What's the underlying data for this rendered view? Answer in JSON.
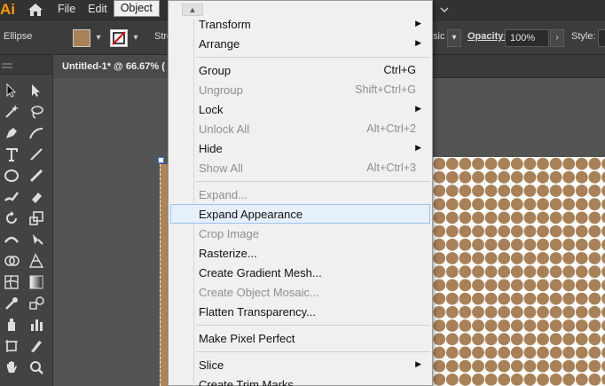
{
  "app": {
    "logo": "Ai"
  },
  "menubar": {
    "items": [
      {
        "label": "File"
      },
      {
        "label": "Edit"
      },
      {
        "label": "Object"
      }
    ]
  },
  "controlbar": {
    "selection_label": "Ellipse",
    "fill_color": "#a88158",
    "stroke_label": "Stro",
    "blend_label": "sic",
    "opacity_label": "Opacity:",
    "opacity_value": "100%",
    "style_label": "Style:"
  },
  "document": {
    "tab_title": "Untitled-1* @ 66.67% ("
  },
  "object_menu": {
    "items": [
      {
        "label": "Transform",
        "shortcut": "",
        "submenu": true,
        "disabled": false
      },
      {
        "label": "Arrange",
        "shortcut": "",
        "submenu": true,
        "disabled": false
      },
      {
        "label": "Group",
        "shortcut": "Ctrl+G",
        "submenu": false,
        "disabled": false
      },
      {
        "label": "Ungroup",
        "shortcut": "Shift+Ctrl+G",
        "submenu": false,
        "disabled": true
      },
      {
        "label": "Lock",
        "shortcut": "",
        "submenu": true,
        "disabled": false
      },
      {
        "label": "Unlock All",
        "shortcut": "Alt+Ctrl+2",
        "submenu": false,
        "disabled": true
      },
      {
        "label": "Hide",
        "shortcut": "",
        "submenu": true,
        "disabled": false
      },
      {
        "label": "Show All",
        "shortcut": "Alt+Ctrl+3",
        "submenu": false,
        "disabled": true
      },
      {
        "label": "Expand...",
        "shortcut": "",
        "submenu": false,
        "disabled": true
      },
      {
        "label": "Expand Appearance",
        "shortcut": "",
        "submenu": false,
        "disabled": false,
        "highlighted": true
      },
      {
        "label": "Crop Image",
        "shortcut": "",
        "submenu": false,
        "disabled": true
      },
      {
        "label": "Rasterize...",
        "shortcut": "",
        "submenu": false,
        "disabled": false
      },
      {
        "label": "Create Gradient Mesh...",
        "shortcut": "",
        "submenu": false,
        "disabled": false
      },
      {
        "label": "Create Object Mosaic...",
        "shortcut": "",
        "submenu": false,
        "disabled": true
      },
      {
        "label": "Flatten Transparency...",
        "shortcut": "",
        "submenu": false,
        "disabled": false
      },
      {
        "label": "Make Pixel Perfect",
        "shortcut": "",
        "submenu": false,
        "disabled": false
      },
      {
        "label": "Slice",
        "shortcut": "",
        "submenu": true,
        "disabled": false
      },
      {
        "label": "Create Trim Marks",
        "shortcut": "",
        "submenu": false,
        "disabled": false
      }
    ]
  },
  "colors": {
    "dot_fill": "#a88158",
    "artboard_fill": "#ae8557",
    "menu_highlight": "#e5f0fb",
    "accent": "#ff9a00"
  },
  "icons": [
    "selection-tool-icon",
    "direct-selection-tool-icon",
    "magic-wand-icon",
    "lasso-icon",
    "pen-tool-icon",
    "curvature-tool-icon",
    "type-tool-icon",
    "line-tool-icon",
    "ellipse-tool-icon",
    "pencil-tool-icon",
    "paintbrush-icon",
    "eraser-icon",
    "rotate-tool-icon",
    "scale-tool-icon",
    "width-tool-icon",
    "puppet-warp-icon",
    "shape-builder-icon",
    "perspective-grid-icon",
    "mesh-tool-icon",
    "gradient-tool-icon",
    "eyedropper-icon",
    "blend-tool-icon",
    "symbol-sprayer-icon",
    "graph-tool-icon",
    "artboard-tool-icon",
    "slice-tool-icon",
    "hand-tool-icon",
    "zoom-tool-icon"
  ]
}
